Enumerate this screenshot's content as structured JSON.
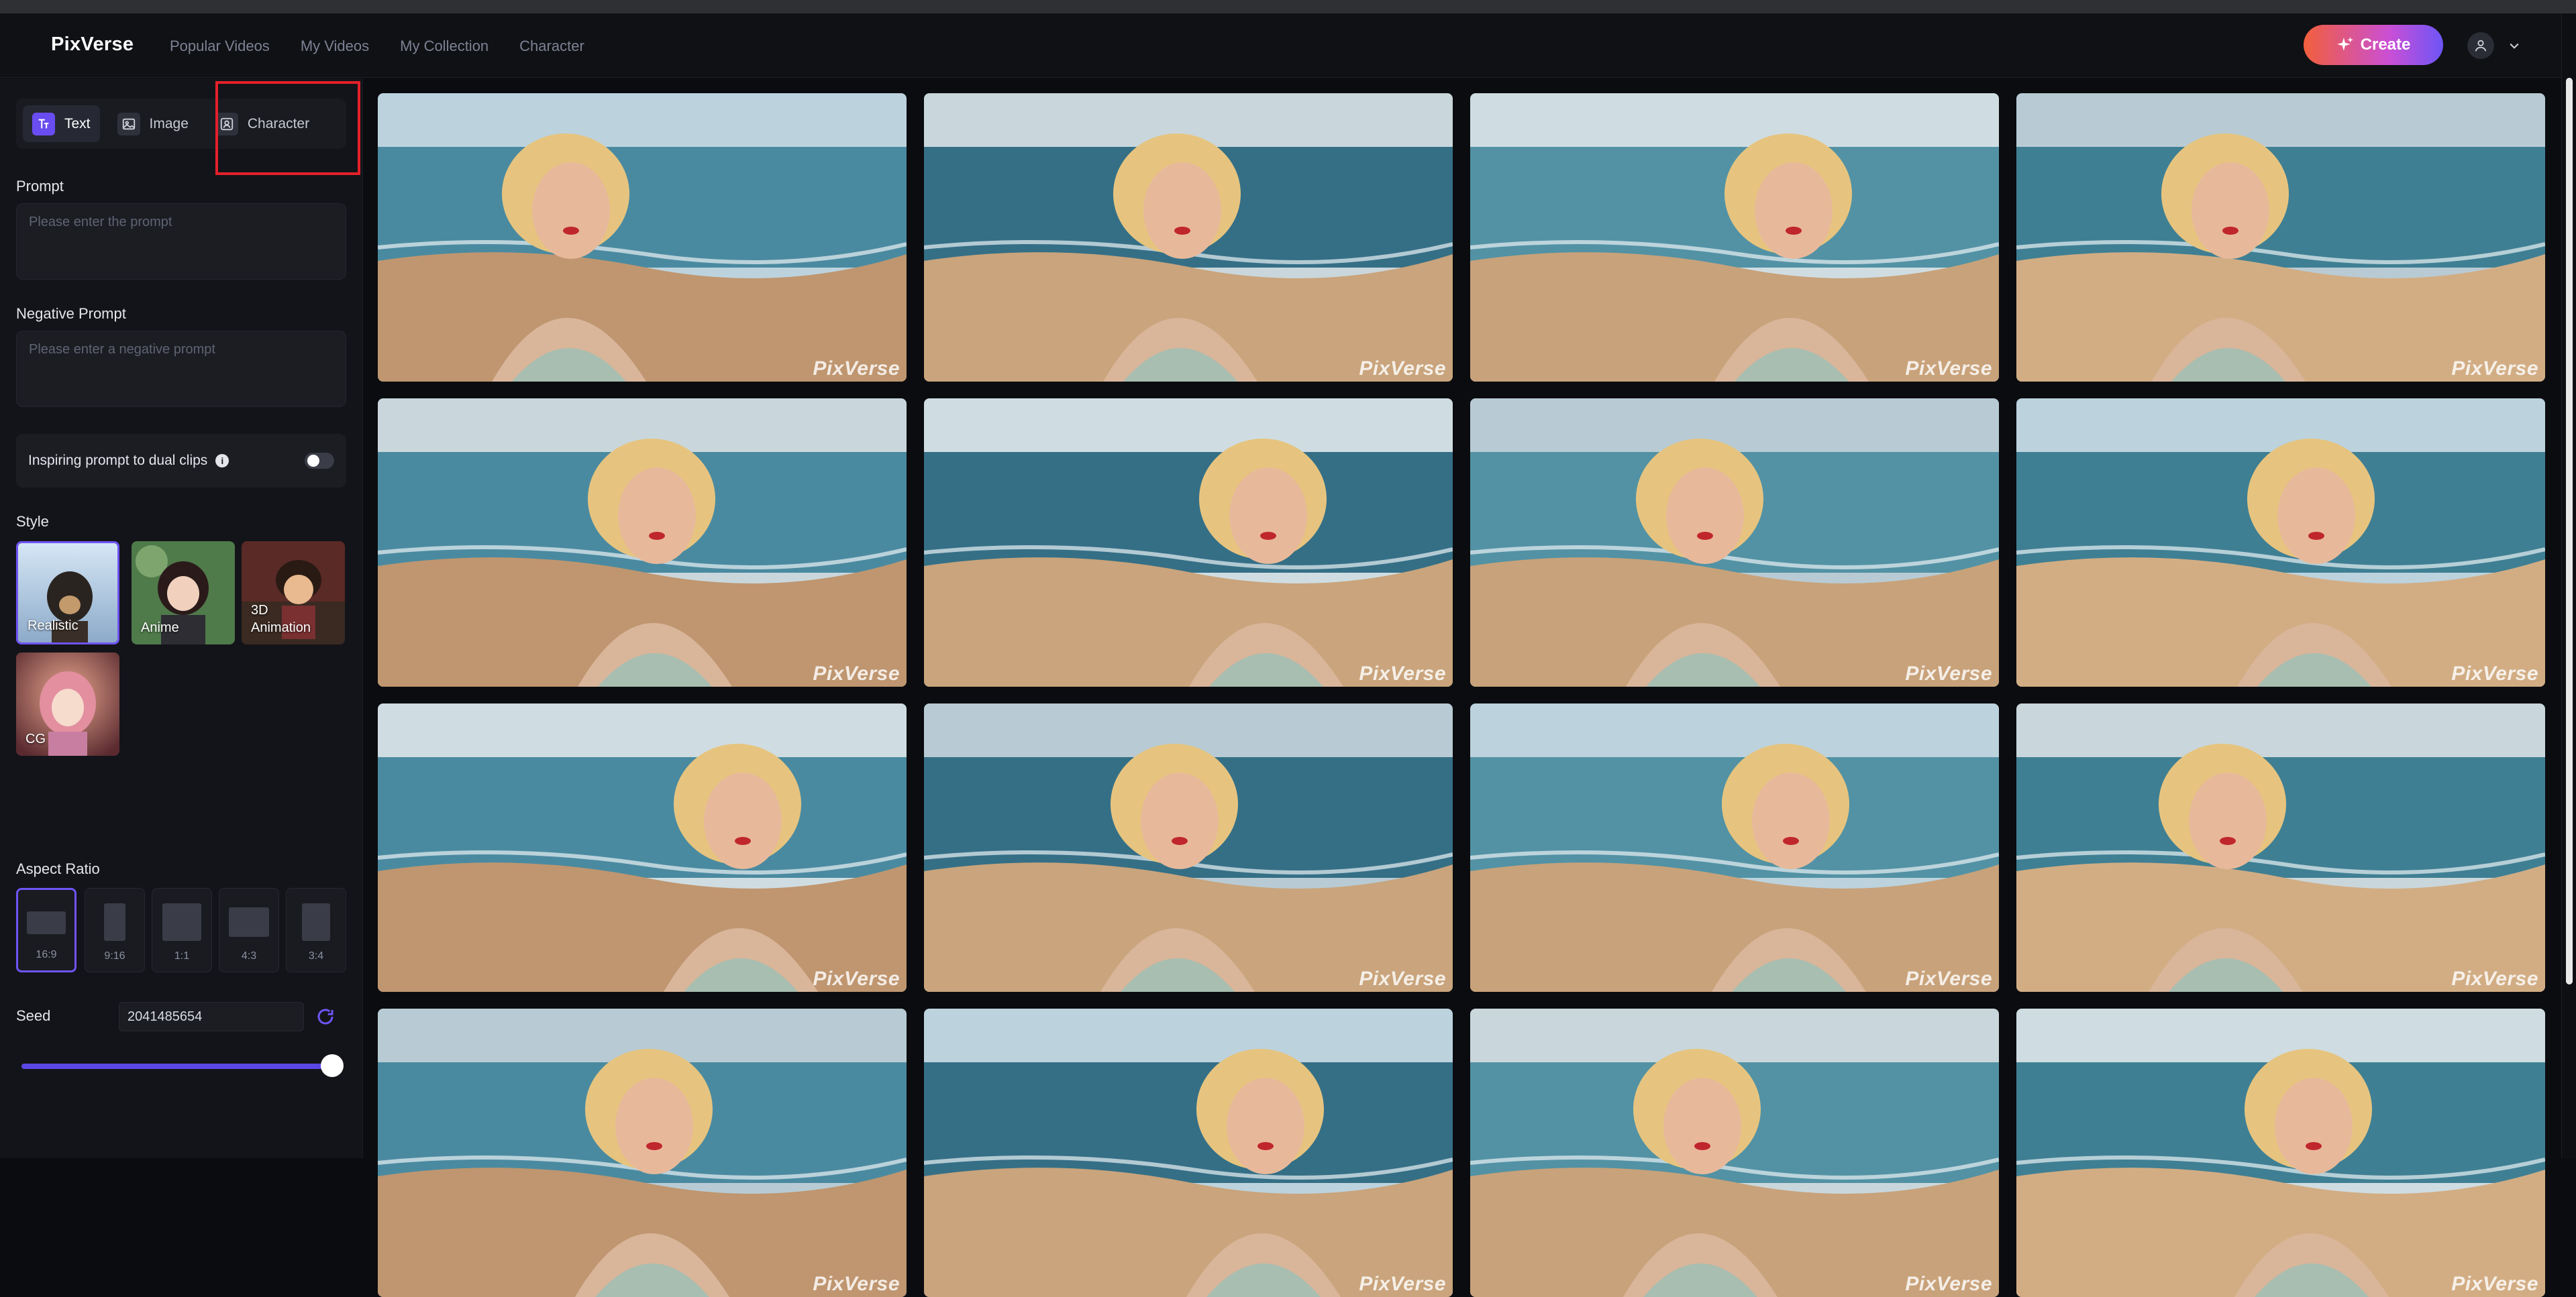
{
  "app": {
    "logo": "PixVerse",
    "nav": [
      "Popular Videos",
      "My Videos",
      "My Collection",
      "Character"
    ],
    "create_label": "Create"
  },
  "sidebar": {
    "modes": [
      {
        "label": "Text",
        "icon": "text-icon",
        "active": true
      },
      {
        "label": "Image",
        "icon": "image-icon",
        "active": false
      },
      {
        "label": "Character",
        "icon": "character-icon",
        "active": false
      }
    ],
    "prompt": {
      "label": "Prompt",
      "placeholder": "Please enter the prompt",
      "value": ""
    },
    "negative_prompt": {
      "label": "Negative Prompt",
      "placeholder": "Please enter a negative prompt",
      "value": ""
    },
    "dual_clips": {
      "label": "Inspiring prompt to dual clips",
      "enabled": false
    },
    "style": {
      "label": "Style",
      "options": [
        {
          "label": "Realistic",
          "active": true
        },
        {
          "label": "Anime",
          "active": false
        },
        {
          "label": "3D\nAnimation",
          "active": false
        },
        {
          "label": "CG",
          "active": false
        }
      ]
    },
    "aspect_ratio": {
      "label": "Aspect Ratio",
      "options": [
        "16:9",
        "9:16",
        "1:1",
        "4:3",
        "3:4"
      ],
      "selected": "16:9"
    },
    "seed": {
      "label": "Seed",
      "value": "2041485654",
      "slider_fraction": 0.98
    }
  },
  "gallery": {
    "watermark": "PixVerse",
    "tile_count": 16
  },
  "colors": {
    "accent": "#6f54f5",
    "highlight": "#e5202a",
    "create_gradient_start": "#f25f3c",
    "create_gradient_end": "#6d55f6"
  }
}
